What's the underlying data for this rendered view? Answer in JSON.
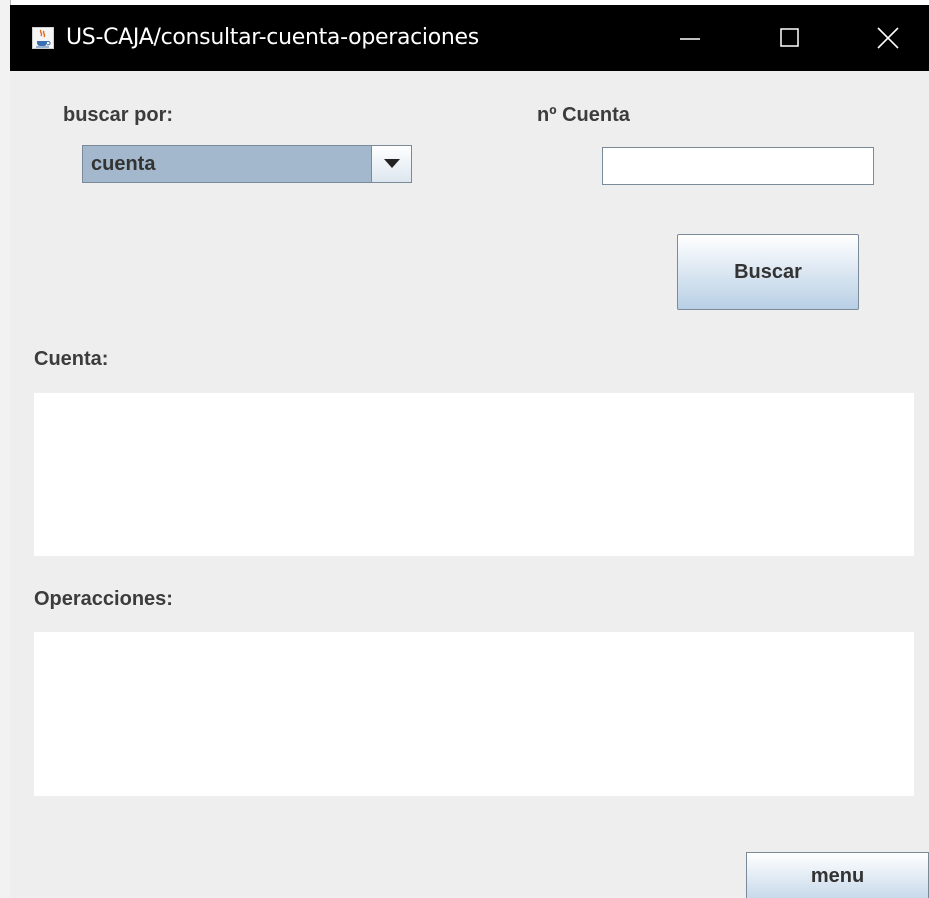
{
  "window": {
    "title": "US-CAJA/consultar-cuenta-operaciones",
    "icon": "java-cup-icon",
    "controls": [
      "minimize-icon",
      "maximize-icon",
      "close-icon"
    ]
  },
  "search": {
    "by_label": "buscar por:",
    "by_selected": "cuenta",
    "account_label": "nº Cuenta",
    "account_value": "",
    "button_label": "Buscar"
  },
  "account_section": {
    "label": "Cuenta:"
  },
  "operations_section": {
    "label": "Operacciones:"
  },
  "footer": {
    "menu_label": "menu"
  },
  "colors": {
    "titlebar": "#000000",
    "window_bg": "#eeeeee",
    "combo_selected_bg": "#a3b8cc",
    "button_gradient_bottom": "#b8cfe5"
  }
}
